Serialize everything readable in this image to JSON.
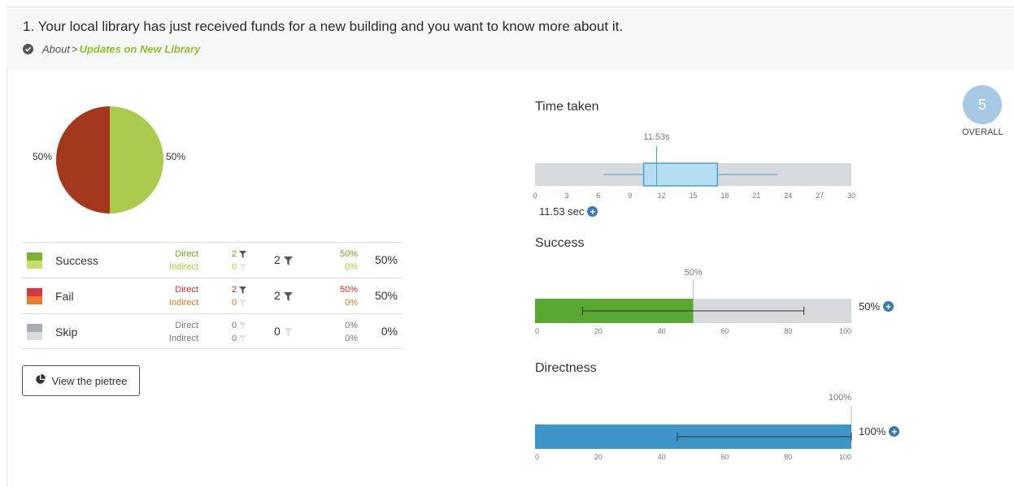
{
  "task": {
    "question": "1. Your local library has just received funds for a new building and you want to know more about it.",
    "breadcrumb_parent": "About",
    "breadcrumb_separator": ">",
    "breadcrumb_current": "Updates on New Library"
  },
  "pie": {
    "left_label": "50%",
    "right_label": "50%",
    "success_share": 0.5,
    "fail_share": 0.5,
    "colors": {
      "success": "#abcb4e",
      "fail": "#a3381c"
    }
  },
  "results": [
    {
      "label": "Success",
      "direct_label": "Direct",
      "indirect_label": "Indirect",
      "direct_count": "2",
      "indirect_count": "0",
      "total": "2",
      "direct_pct": "50%",
      "indirect_pct": "0%",
      "pct": "50%",
      "colors": {
        "top": "#7db335",
        "bottom": "#c3de6a",
        "direct_text": "#6ea12a",
        "indirect_text": "#a8c93d"
      }
    },
    {
      "label": "Fail",
      "direct_label": "Direct",
      "indirect_label": "Indirect",
      "direct_count": "2",
      "indirect_count": "0",
      "total": "2",
      "direct_pct": "50%",
      "indirect_pct": "0%",
      "pct": "50%",
      "colors": {
        "top": "#d13a45",
        "bottom": "#ec7b2e",
        "direct_text": "#c9302c",
        "indirect_text": "#e8742a"
      }
    },
    {
      "label": "Skip",
      "direct_label": "Direct",
      "indirect_label": "Indirect",
      "direct_count": "0",
      "indirect_count": "0",
      "total": "0",
      "direct_pct": "0%",
      "indirect_pct": "0%",
      "pct": "0%",
      "colors": {
        "top": "#a9adb0",
        "bottom": "#d9dcde",
        "direct_text": "#777777",
        "indirect_text": "#777777"
      }
    }
  ],
  "pietree_button": {
    "label": "View the pietree"
  },
  "overall": {
    "score": "5",
    "label": "OVERALL"
  },
  "time_taken": {
    "title": "Time taken",
    "marker_label": "11.53s",
    "median": 11.53,
    "whisker_min": 6.5,
    "q1": 10.3,
    "q3": 17.3,
    "whisker_max": 23,
    "axis_min": 0,
    "axis_max": 30,
    "ticks": [
      "0",
      "3",
      "6",
      "9",
      "12",
      "15",
      "18",
      "21",
      "24",
      "27",
      "30"
    ],
    "value": "11.53 sec"
  },
  "success": {
    "title": "Success",
    "marker_label": "50%",
    "value_pct": 50,
    "error_low": 15,
    "error_high": 85,
    "ticks": [
      "0",
      "20",
      "40",
      "60",
      "80",
      "100"
    ],
    "value": "50%",
    "colors": {
      "fill": "#5aa834",
      "track": "#d6dadc"
    }
  },
  "directness": {
    "title": "Directness",
    "marker_label": "100%",
    "value_pct": 100,
    "error_low": 45,
    "error_high": 100,
    "ticks": [
      "0",
      "20",
      "40",
      "60",
      "80",
      "100"
    ],
    "value": "100%",
    "colors": {
      "fill": "#3d94c7",
      "track": "#d6dadc"
    }
  }
}
